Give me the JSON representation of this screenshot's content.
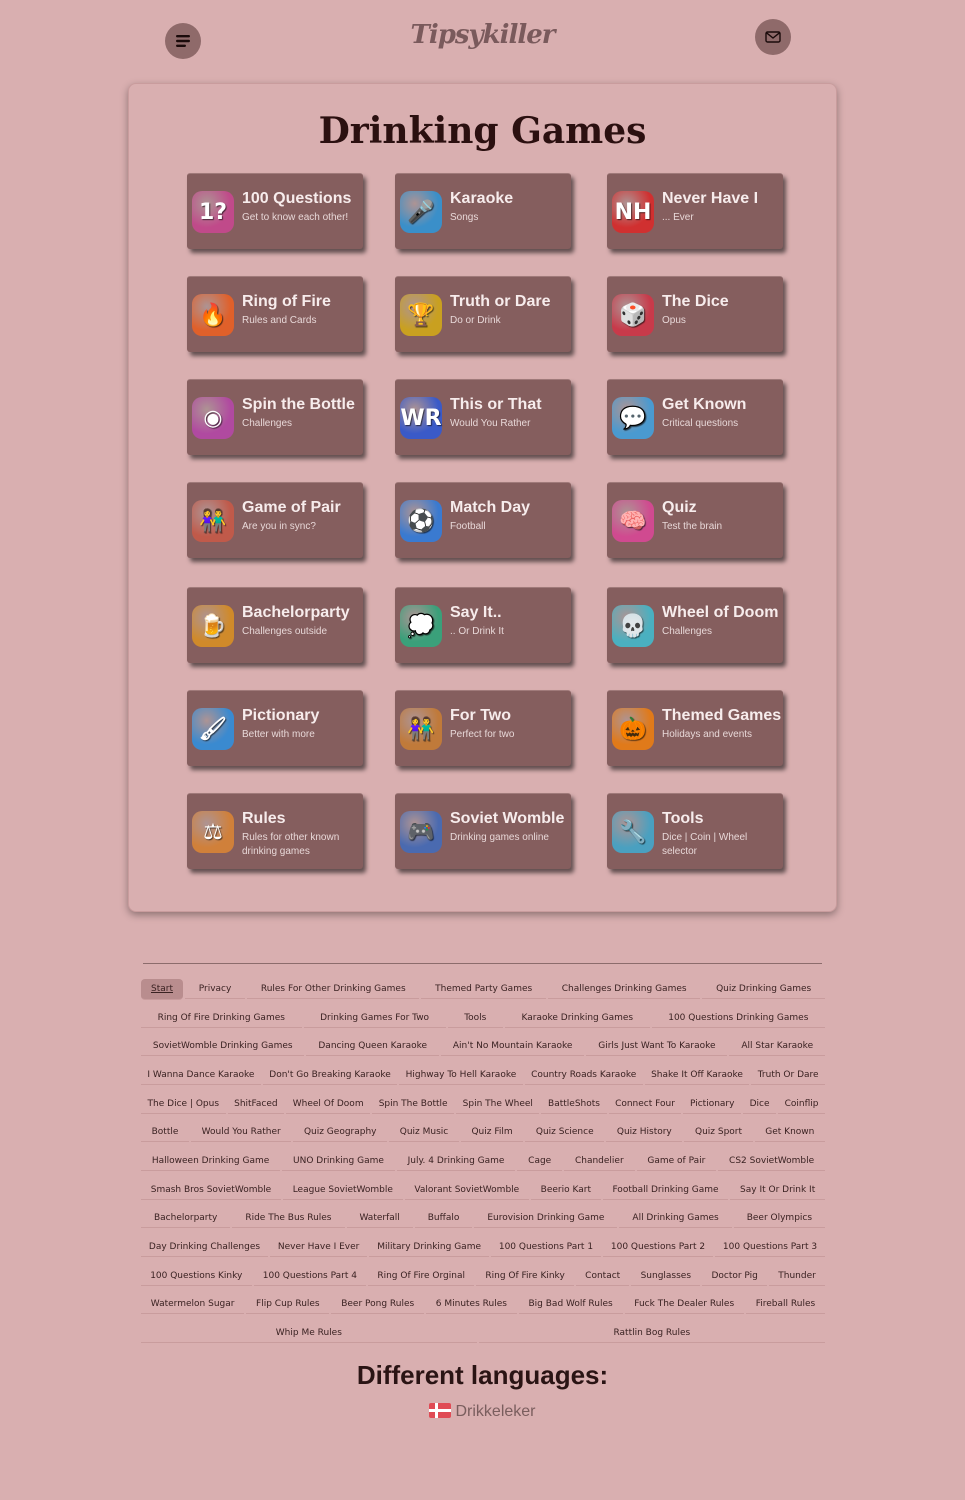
{
  "header": {
    "logo": "Tipsykiller"
  },
  "main": {
    "title": "Drinking Games",
    "games": [
      {
        "title": "100 Questions",
        "subtitle": "Get to know each other!",
        "icon": "question-marks-icon",
        "glyph": "1?",
        "color": "#c04a8a"
      },
      {
        "title": "Karaoke",
        "subtitle": "Songs",
        "icon": "microphone-icon",
        "glyph": "🎤",
        "color": "#3a8fc9"
      },
      {
        "title": "Never Have I",
        "subtitle": "... Ever",
        "icon": "never-have-i-ever-icon",
        "glyph": "NH",
        "color": "#d03030"
      },
      {
        "title": "Ring of Fire",
        "subtitle": "Rules and Cards",
        "icon": "flame-icon",
        "glyph": "🔥",
        "color": "#e0602a"
      },
      {
        "title": "Truth or Dare",
        "subtitle": "Do or Drink",
        "icon": "trophy-icon",
        "glyph": "🏆",
        "color": "#c9a020"
      },
      {
        "title": "The Dice",
        "subtitle": "Opus",
        "icon": "dice-icon",
        "glyph": "🎲",
        "color": "#c83a4a"
      },
      {
        "title": "Spin the Bottle",
        "subtitle": "Challenges",
        "icon": "spinning-top-icon",
        "glyph": "◉",
        "color": "#b04aa0"
      },
      {
        "title": "This or That",
        "subtitle": "Would You Rather",
        "icon": "would-you-rather-icon",
        "glyph": "WR",
        "color": "#3a5ac8"
      },
      {
        "title": "Get Known",
        "subtitle": "Critical questions",
        "icon": "two-people-chat-icon",
        "glyph": "💬",
        "color": "#4a9ad0"
      },
      {
        "title": "Game of Pair",
        "subtitle": "Are you in sync?",
        "icon": "couple-icon",
        "glyph": "👫",
        "color": "#c05a4a"
      },
      {
        "title": "Match Day",
        "subtitle": "Football",
        "icon": "football-icon",
        "glyph": "⚽",
        "color": "#3a7ad0"
      },
      {
        "title": "Quiz",
        "subtitle": "Test the brain",
        "icon": "brain-icon",
        "glyph": "🧠",
        "color": "#d04a90"
      },
      {
        "title": "Bachelorparty",
        "subtitle": "Challenges outside",
        "icon": "beer-mugs-icon",
        "glyph": "🍺",
        "color": "#d08a2a"
      },
      {
        "title": "Say It..",
        "subtitle": ".. Or Drink It",
        "icon": "speech-beer-icon",
        "glyph": "💭",
        "color": "#3aa07a"
      },
      {
        "title": "Wheel of Doom",
        "subtitle": "Challenges",
        "icon": "skull-icon",
        "glyph": "💀",
        "color": "#4ab0c0"
      },
      {
        "title": "Pictionary",
        "subtitle": "Better with more",
        "icon": "paintbrush-icon",
        "glyph": "🖌",
        "color": "#3a8ad0"
      },
      {
        "title": "For Two",
        "subtitle": "Perfect for two",
        "icon": "couple-icon",
        "glyph": "👫",
        "color": "#c07a3a"
      },
      {
        "title": "Themed Games",
        "subtitle": "Holidays and events",
        "icon": "pumpkin-icon",
        "glyph": "🎃",
        "color": "#e07a1a"
      },
      {
        "title": "Rules",
        "subtitle": "Rules for other known drinking games",
        "icon": "gavel-icon",
        "glyph": "⚖",
        "color": "#d0803a"
      },
      {
        "title": "Soviet Womble",
        "subtitle": "Drinking games online",
        "icon": "gamepad-icon",
        "glyph": "🎮",
        "color": "#4a6ab0"
      },
      {
        "title": "Tools",
        "subtitle": "Dice | Coin | Wheel selector",
        "icon": "wrench-icon",
        "glyph": "🔧",
        "color": "#4aa0c0"
      }
    ]
  },
  "footer": {
    "link_rows": [
      [
        "Start",
        "Privacy",
        "Rules For Other Drinking Games",
        "Themed Party Games",
        "Challenges Drinking Games",
        "Quiz Drinking Games"
      ],
      [
        "Ring Of Fire Drinking Games",
        "Drinking Games For Two",
        "Tools",
        "Karaoke Drinking Games",
        "100 Questions Drinking Games"
      ],
      [
        "SovietWomble Drinking Games",
        "Dancing Queen Karaoke",
        "Ain't No Mountain Karaoke",
        "Girls Just Want To Karaoke",
        "All Star Karaoke"
      ],
      [
        "I Wanna Dance Karaoke",
        "Don't Go Breaking Karaoke",
        "Highway To Hell Karaoke",
        "Country Roads Karaoke",
        "Shake It Off Karaoke",
        "Truth Or Dare"
      ],
      [
        "The Dice | Opus",
        "ShitFaced",
        "Wheel Of Doom",
        "Spin The Bottle",
        "Spin The Wheel",
        "BattleShots",
        "Connect Four",
        "Pictionary",
        "Dice",
        "Coinflip"
      ],
      [
        "Bottle",
        "Would You Rather",
        "Quiz Geography",
        "Quiz Music",
        "Quiz Film",
        "Quiz Science",
        "Quiz History",
        "Quiz Sport",
        "Get Known"
      ],
      [
        "Halloween Drinking Game",
        "UNO Drinking Game",
        "July. 4 Drinking Game",
        "Cage",
        "Chandelier",
        "Game of Pair",
        "CS2 SovietWomble"
      ],
      [
        "Smash Bros SovietWomble",
        "League SovietWomble",
        "Valorant SovietWomble",
        "Beerio Kart",
        "Football Drinking Game",
        "Say It Or Drink It"
      ],
      [
        "Bachelorparty",
        "Ride The Bus Rules",
        "Waterfall",
        "Buffalo",
        "Eurovision Drinking Game",
        "All Drinking Games",
        "Beer Olympics"
      ],
      [
        "Day Drinking Challenges",
        "Never Have I Ever",
        "Military Drinking Game",
        "100 Questions Part 1",
        "100 Questions Part 2",
        "100 Questions Part 3"
      ],
      [
        "100 Questions Kinky",
        "100 Questions Part 4",
        "Ring Of Fire Orginal",
        "Ring Of Fire Kinky",
        "Contact",
        "Sunglasses",
        "Doctor Pig",
        "Thunder"
      ],
      [
        "Watermelon Sugar",
        "Flip Cup Rules",
        "Beer Pong Rules",
        "6 Minutes Rules",
        "Big Bad Wolf Rules",
        "Fuck The Dealer Rules",
        "Fireball Rules"
      ],
      [
        "Whip Me Rules",
        "Rattlin Bog Rules"
      ]
    ],
    "languages_title": "Different languages:",
    "language_link": "Drikkeleker"
  }
}
